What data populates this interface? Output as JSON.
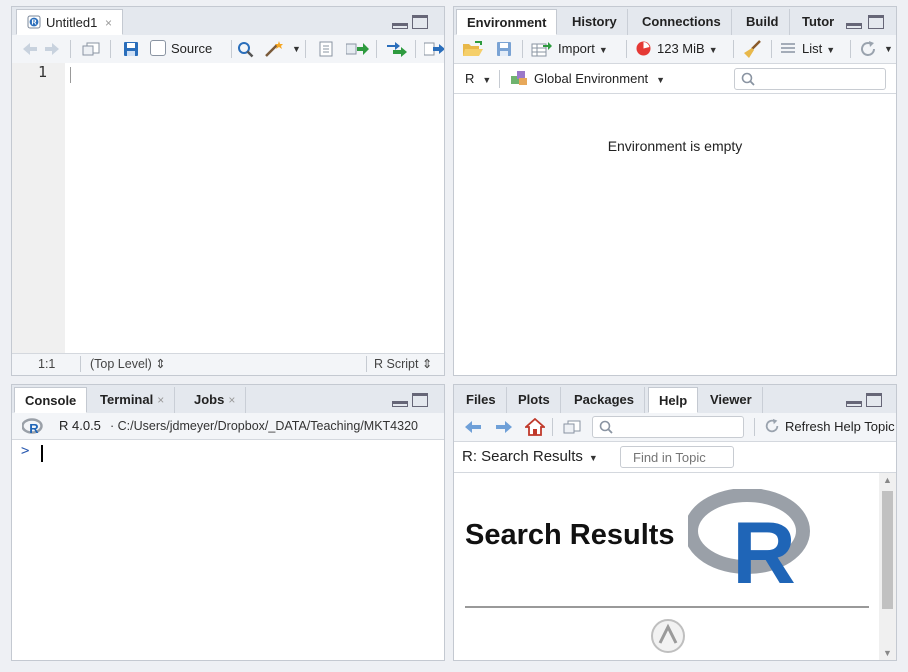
{
  "source_pane": {
    "tab": {
      "label": "Untitled1",
      "close": "×"
    },
    "toolbar": {
      "source_label": "Source"
    },
    "editor": {
      "line_number": "1"
    },
    "status": {
      "position": "1:1",
      "scope": "(Top Level) ⇕",
      "file_type": "R Script ⇕"
    }
  },
  "env_pane": {
    "tabs": [
      "Environment",
      "History",
      "Connections",
      "Build",
      "Tutor"
    ],
    "toolbar": {
      "import_label": "Import",
      "memory_label": "123 MiB",
      "view_label": "List"
    },
    "subbar": {
      "language": "R",
      "scope": "Global Environment"
    },
    "message": "Environment is empty"
  },
  "console_pane": {
    "tabs": [
      {
        "label": "Console"
      },
      {
        "label": "Terminal",
        "close": "×"
      },
      {
        "label": "Jobs",
        "close": "×"
      }
    ],
    "version": "R 4.0.5",
    "path": "· C:/Users/jdmeyer/Dropbox/_DATA/Teaching/MKT4320",
    "prompt": ">"
  },
  "help_pane": {
    "tabs": [
      "Files",
      "Plots",
      "Packages",
      "Help",
      "Viewer"
    ],
    "toolbar": {
      "refresh_label": "Refresh Help Topic"
    },
    "subbar": {
      "topic": "R: Search Results",
      "find_placeholder": "Find in Topic"
    },
    "content": {
      "heading": "Search Results"
    }
  },
  "colors": {
    "accent_blue": "#2a6ebb",
    "r_logo_blue": "#1f65b7",
    "r_logo_gray": "#9aa0a8",
    "memory_red": "#e53935"
  }
}
